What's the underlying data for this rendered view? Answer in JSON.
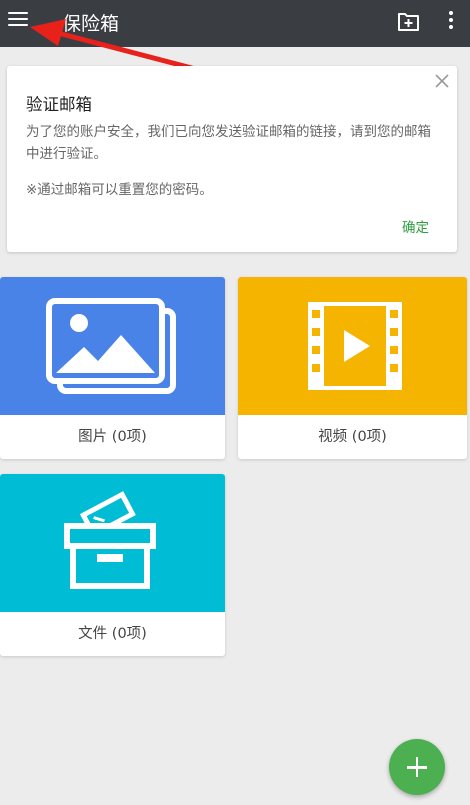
{
  "appbar": {
    "title": "保险箱",
    "menu_icon": "hamburger-menu-icon",
    "add_folder_icon": "folder-add-icon",
    "more_icon": "more-vertical-icon",
    "background": "#3a3d42"
  },
  "verify_card": {
    "title": "验证邮箱",
    "body": "为了您的账户安全，我们已向您发送验证邮箱的链接，请到您的邮箱中进行验证。",
    "note": "※通过邮箱可以重置您的密码。",
    "confirm_label": "确定",
    "close_icon": "close-icon",
    "accent": "#2e9e3f"
  },
  "categories": [
    {
      "label": "图片 (0项)",
      "icon": "image-gallery-icon",
      "color": "#4a83e8"
    },
    {
      "label": "视频 (0项)",
      "icon": "video-film-icon",
      "color": "#f4b400"
    },
    {
      "label": "文件 (0项)",
      "icon": "archive-box-icon",
      "color": "#00bcd4"
    }
  ],
  "fab": {
    "icon": "plus-icon",
    "color": "#4caf50"
  },
  "annotation": {
    "arrow_color": "#e8221b"
  }
}
